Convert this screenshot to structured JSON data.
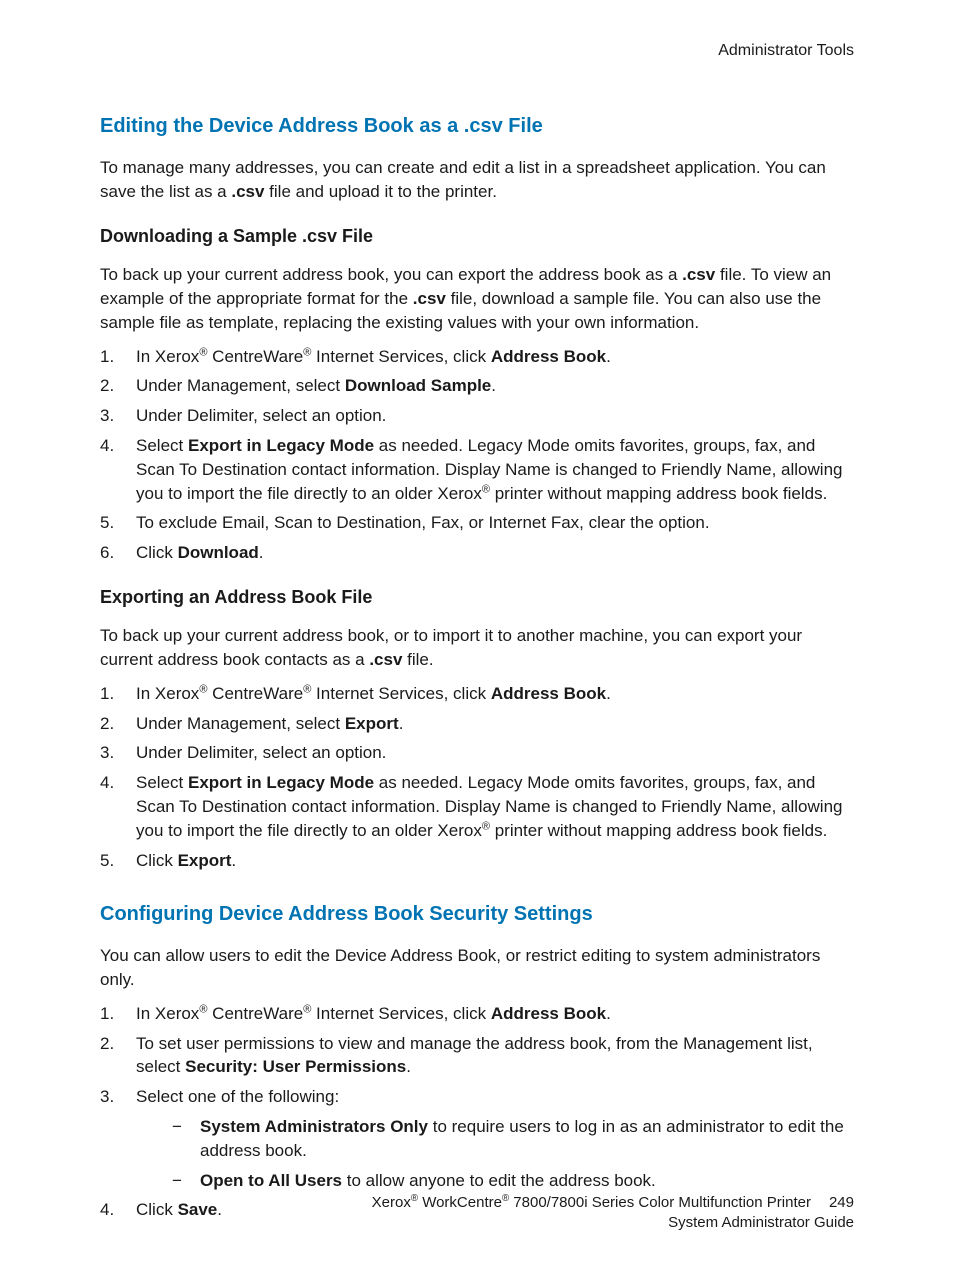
{
  "header": {
    "right_text": "Administrator Tools"
  },
  "section1": {
    "title": "Editing the Device Address Book as a .csv File",
    "intro_pre": "To manage many addresses, you can create and edit a list in a spreadsheet application. You can save the list as a ",
    "intro_bold": ".csv",
    "intro_post": " file and upload it to the printer.",
    "sub1": {
      "title": "Downloading a Sample .csv File",
      "intro_a": "To back up your current address book, you can export the address book as a ",
      "intro_bold1": ".csv",
      "intro_b": " file. To view an example of the appropriate format for the ",
      "intro_bold2": ".csv",
      "intro_c": " file, download a sample file. You can also use the sample file as template, replacing the existing values with your own information.",
      "steps": {
        "s1_a": "In Xerox",
        "s1_b": " CentreWare",
        "s1_c": " Internet Services, click ",
        "s1_bold": "Address Book",
        "s1_d": ".",
        "s2_a": "Under Management, select ",
        "s2_bold": "Download Sample",
        "s2_b": ".",
        "s3": "Under Delimiter, select an option.",
        "s4_a": "Select ",
        "s4_bold": "Export in Legacy Mode",
        "s4_b": " as needed. Legacy Mode omits favorites, groups, fax, and Scan To Destination contact information. Display Name is changed to Friendly Name, allowing you to import the file directly to an older Xerox",
        "s4_c": " printer without mapping address book fields.",
        "s5": "To exclude Email, Scan to Destination, Fax, or Internet Fax, clear the option.",
        "s6_a": "Click ",
        "s6_bold": "Download",
        "s6_b": "."
      }
    },
    "sub2": {
      "title": "Exporting an Address Book File",
      "intro_a": "To back up your current address book, or to import it to another machine, you can export your current address book contacts as a ",
      "intro_bold": ".csv",
      "intro_b": " file.",
      "steps": {
        "s1_a": "In Xerox",
        "s1_b": " CentreWare",
        "s1_c": " Internet Services, click ",
        "s1_bold": "Address Book",
        "s1_d": ".",
        "s2_a": "Under Management, select ",
        "s2_bold": "Export",
        "s2_b": ".",
        "s3": "Under Delimiter, select an option.",
        "s4_a": "Select ",
        "s4_bold": "Export in Legacy Mode",
        "s4_b": " as needed. Legacy Mode omits favorites, groups, fax, and Scan To Destination contact information. Display Name is changed to Friendly Name, allowing you to import the file directly to an older Xerox",
        "s4_c": " printer without mapping address book fields.",
        "s5_a": "Click ",
        "s5_bold": "Export",
        "s5_b": "."
      }
    }
  },
  "section2": {
    "title": "Configuring Device Address Book Security Settings",
    "intro": "You can allow users to edit the Device Address Book, or restrict editing to system administrators only.",
    "steps": {
      "s1_a": "In Xerox",
      "s1_b": " CentreWare",
      "s1_c": " Internet Services, click ",
      "s1_bold": "Address Book",
      "s1_d": ".",
      "s2_a": "To set user permissions to view and manage the address book, from the Management list, select ",
      "s2_bold": "Security: User Permissions",
      "s2_b": ".",
      "s3": "Select one of the following:",
      "s3_bullets": {
        "b1_bold": "System Administrators Only",
        "b1_rest": " to require users to log in as an administrator to edit the address book.",
        "b2_bold": "Open to All Users",
        "b2_rest": " to allow anyone to edit the address book."
      },
      "s4_a": "Click ",
      "s4_bold": "Save",
      "s4_b": "."
    }
  },
  "footer": {
    "brand_a": "Xerox",
    "brand_b": " WorkCentre",
    "brand_c": " 7800/7800i Series Color Multifunction Printer",
    "line2": "System Administrator Guide",
    "page": "249"
  },
  "reg": "®"
}
